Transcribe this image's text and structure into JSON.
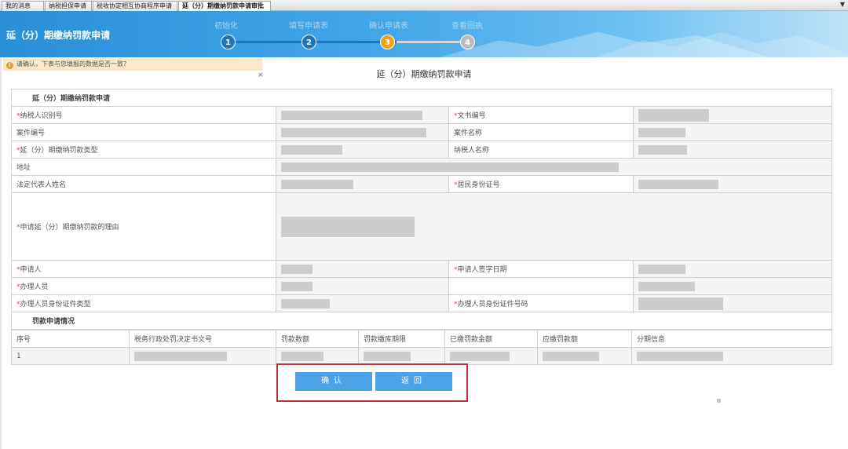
{
  "tabs": [
    {
      "label": "我的消息",
      "active": false
    },
    {
      "label": "纳税担保申请",
      "active": false
    },
    {
      "label": "税收协定相互协商程序申请",
      "active": false
    },
    {
      "label": "延（分）期缴纳罚款申请审批",
      "active": true
    }
  ],
  "tab_menu_icon": "chevron-down-icon",
  "header": {
    "title": "延（分）期缴纳罚款申请",
    "steps": [
      {
        "label": "初始化",
        "number": "1",
        "state": "done"
      },
      {
        "label": "填写申请表",
        "number": "2",
        "state": "done"
      },
      {
        "label": "确认申请表",
        "number": "3",
        "state": "current"
      },
      {
        "label": "查看回执",
        "number": "4",
        "state": "todo"
      }
    ]
  },
  "notice": {
    "icon": "info-icon",
    "text": "请确认，下表与您填报的数据是否一致?",
    "close": "×"
  },
  "form_title": "延（分）期缴纳罚款申请",
  "form": {
    "section_title": "延（分）期缴纳罚款申请",
    "labels": {
      "taxpayer_id": "纳税人识别号",
      "doc_no": "文书编号",
      "case_no": "案件编号",
      "case_name": "案件名称",
      "penalty_type": "延（分）期缴纳罚款类型",
      "taxpayer_name": "纳税人名称",
      "address": "地址",
      "legal_rep": "法定代表人姓名",
      "resident_id": "居民身份证号",
      "reason": "申请延（分）期缴纳罚款的理由",
      "applicant": "申请人",
      "sign_date": "申请人签字日期",
      "handler": "办理人员",
      "handler_id_type": "办理人员身份证件类型",
      "handler_id_no": "办理人员身份证件号码"
    },
    "required_mark": "*"
  },
  "penalty": {
    "section_title": "罚款申请情况",
    "columns": [
      "序号",
      "税务行政处罚决定书文号",
      "罚款数额",
      "罚款缴库期限",
      "已缴罚款金额",
      "应缴罚款额",
      "分期信息"
    ],
    "rows": [
      {
        "index": "1"
      }
    ]
  },
  "buttons": {
    "confirm": "确认",
    "back": "返回"
  },
  "colors": {
    "header_blue": "#2a8fd6",
    "step_done": "#1b76bd",
    "step_current": "#f5a30b",
    "step_todo": "#bcbcbc",
    "required_red": "#e24a4a",
    "button_blue": "#4ba2e6",
    "highlight_box": "#c0313b",
    "notice_bg": "#fbe9c6"
  }
}
